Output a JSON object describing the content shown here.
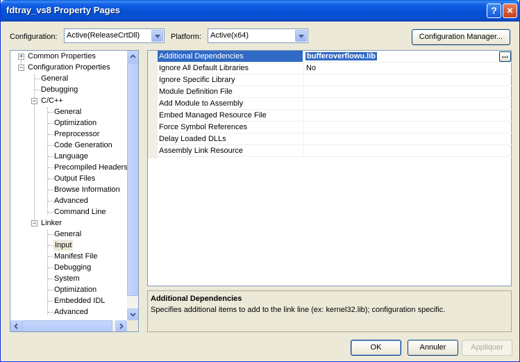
{
  "window": {
    "title": "fdtray_vs8 Property Pages",
    "help_glyph": "?",
    "close_glyph": "×"
  },
  "toolbar": {
    "configuration_label": "Configuration:",
    "configuration_value": "Active(ReleaseCrtDll)",
    "platform_label": "Platform:",
    "platform_value": "Active(x64)",
    "config_manager_label": "Configuration Manager..."
  },
  "tree": {
    "common_properties": "Common Properties",
    "configuration_properties": "Configuration Properties",
    "general": "General",
    "debugging": "Debugging",
    "cpp": "C/C++",
    "cpp_items": [
      "General",
      "Optimization",
      "Preprocessor",
      "Code Generation",
      "Language",
      "Precompiled Headers",
      "Output Files",
      "Browse Information",
      "Advanced",
      "Command Line"
    ],
    "linker": "Linker",
    "linker_items": [
      "General",
      "Input",
      "Manifest File",
      "Debugging",
      "System",
      "Optimization",
      "Embedded IDL",
      "Advanced"
    ],
    "selected": "Input",
    "expander_plus": "+",
    "expander_minus": "−"
  },
  "properties": [
    {
      "name": "Additional Dependencies",
      "value": "bufferoverflowu.lib"
    },
    {
      "name": "Ignore All Default Libraries",
      "value": "No"
    },
    {
      "name": "Ignore Specific Library",
      "value": ""
    },
    {
      "name": "Module Definition File",
      "value": ""
    },
    {
      "name": "Add Module to Assembly",
      "value": ""
    },
    {
      "name": "Embed Managed Resource File",
      "value": ""
    },
    {
      "name": "Force Symbol References",
      "value": ""
    },
    {
      "name": "Delay Loaded DLLs",
      "value": ""
    },
    {
      "name": "Assembly Link Resource",
      "value": ""
    }
  ],
  "ellipsis_label": "...",
  "description": {
    "title": "Additional Dependencies",
    "text": "Specifies additional items to add to the link line (ex: kernel32.lib); configuration specific."
  },
  "buttons": {
    "ok": "OK",
    "cancel": "Annuler",
    "apply": "Appliquer"
  },
  "colors": {
    "selection": "#316ac5",
    "titlebar": "#0350d6",
    "dialog_bg": "#ece9d8"
  }
}
